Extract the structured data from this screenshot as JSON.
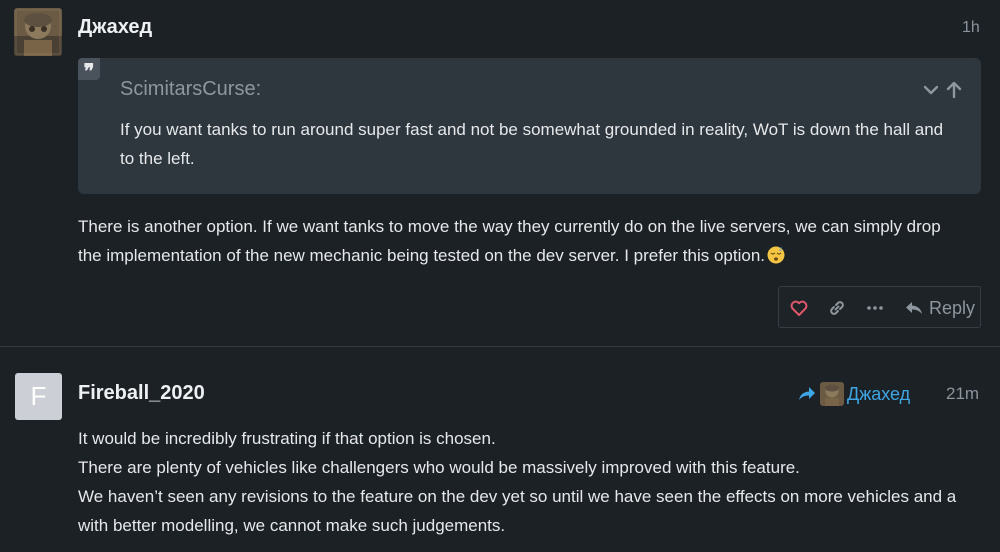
{
  "post1": {
    "username": "Джахед",
    "time": "1h",
    "quote": {
      "author": "ScimitarsCurse:",
      "text": "If you want tanks to run around super fast and not be somewhat grounded in reality, WoT is down the hall and to the left."
    },
    "body_line1": "There is another option. If we want tanks to move the way they currently do on the live servers, we can simply drop",
    "body_line2": "the implementation of the new mechanic being tested on the dev server. I prefer this option.",
    "emoji_icon": "sleeping-face-emoji",
    "actions": {
      "reply_label": "Reply"
    }
  },
  "post2": {
    "avatar_letter": "F",
    "username": "Fireball_2020",
    "reply_to": "Джахед",
    "time": "21m",
    "lines": [
      "It would be incredibly frustrating if that option is chosen.",
      "There are plenty of vehicles like challengers who would be massively improved with this feature.",
      "We haven’t seen any revisions to the feature on the dev yet so until we have seen the effects on more vehicles and a",
      "with better modelling, we cannot make such judgements."
    ]
  },
  "colors": {
    "background": "#1c2126",
    "quote_bg": "#2e363e",
    "like_heart": "#e0566a",
    "link_blue": "#3fa6e6",
    "muted": "#8e969e"
  }
}
